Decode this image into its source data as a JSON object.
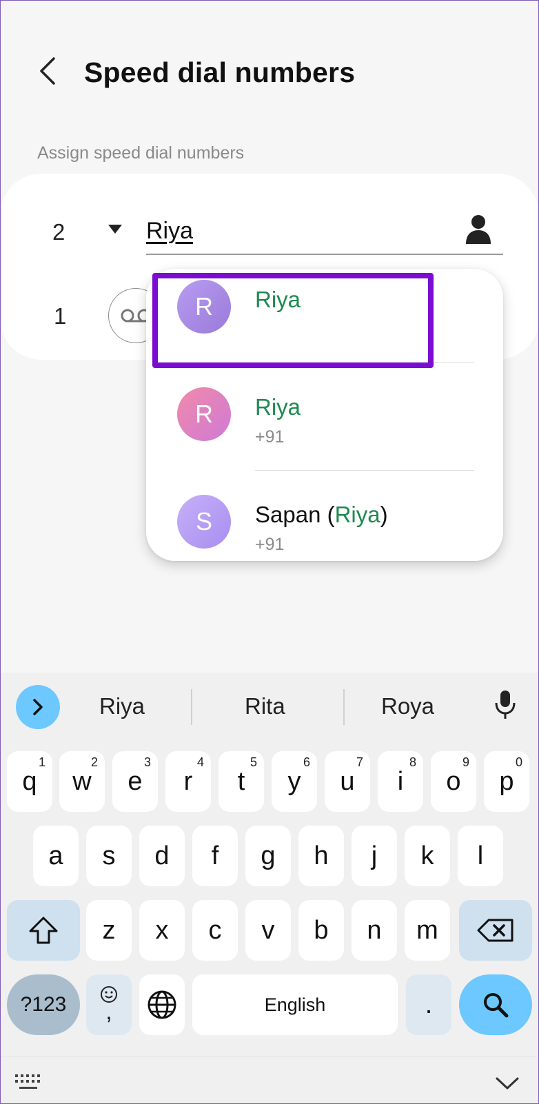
{
  "header": {
    "title": "Speed dial numbers",
    "back_icon": "chevron-left-icon"
  },
  "section": {
    "label": "Assign speed dial numbers"
  },
  "rows": [
    {
      "number": "2",
      "input_value": "Riya",
      "caret_icon": "triangle-down-icon",
      "contact_icon": "person-icon"
    },
    {
      "number": "1",
      "icon": "voicemail-icon"
    }
  ],
  "suggestions": [
    {
      "initial": "R",
      "prefix": "",
      "match": "Riya",
      "suffix": "",
      "sub": "",
      "avatar_color": "#a78be0"
    },
    {
      "initial": "R",
      "prefix": "",
      "match": "Riya",
      "suffix": "",
      "sub": "+91",
      "avatar_color": "#e07fb0"
    },
    {
      "initial": "S",
      "prefix": "Sapan (",
      "match": "Riya",
      "suffix": ")",
      "sub": "+91",
      "avatar_color": "#b39af0"
    }
  ],
  "colors": {
    "match_green": "#1e8a4f",
    "highlight_purple": "#7a0dcf",
    "keyboard_accent": "#6cc8ff"
  },
  "keyboard": {
    "suggestions": [
      "Riya",
      "Rita",
      "Roya"
    ],
    "row1": [
      {
        "k": "q",
        "h": "1"
      },
      {
        "k": "w",
        "h": "2"
      },
      {
        "k": "e",
        "h": "3"
      },
      {
        "k": "r",
        "h": "4"
      },
      {
        "k": "t",
        "h": "5"
      },
      {
        "k": "y",
        "h": "6"
      },
      {
        "k": "u",
        "h": "7"
      },
      {
        "k": "i",
        "h": "8"
      },
      {
        "k": "o",
        "h": "9"
      },
      {
        "k": "p",
        "h": "0"
      }
    ],
    "row2": [
      "a",
      "s",
      "d",
      "f",
      "g",
      "h",
      "j",
      "k",
      "l"
    ],
    "row3": [
      "z",
      "x",
      "c",
      "v",
      "b",
      "n",
      "m"
    ],
    "symbols_label": "?123",
    "emoji_comma": ",",
    "space_label": "English",
    "period_label": "."
  }
}
